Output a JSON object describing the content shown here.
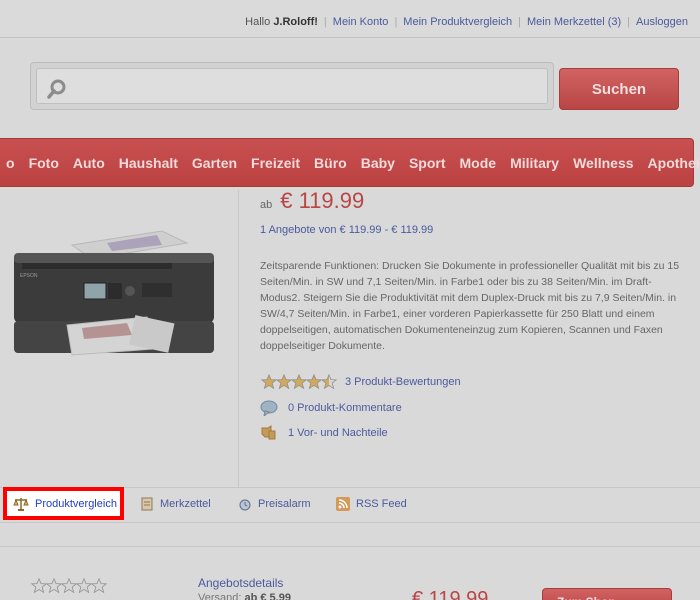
{
  "header": {
    "greeting_prefix": "Hallo",
    "username": "J.Roloff!",
    "links": [
      "Mein Konto",
      "Mein Produktvergleich",
      "Mein Merkzettel (3)",
      "Ausloggen"
    ]
  },
  "search": {
    "value": "",
    "placeholder": "",
    "button_label": "Suchen"
  },
  "nav": {
    "items": [
      "o",
      "Foto",
      "Auto",
      "Haushalt",
      "Garten",
      "Freizeit",
      "Büro",
      "Baby",
      "Sport",
      "Mode",
      "Military",
      "Wellness",
      "Apotheke"
    ]
  },
  "product": {
    "price_prefix": "ab",
    "price": "€ 119.99",
    "offers": "1 Angebote von € 119.99 - € 119.99",
    "description": "Zeitsparende Funktionen: Drucken Sie Dokumente in professioneller Qualität mit bis zu 15 Seiten/Min. in SW und 7,1 Seiten/Min. in Farbe1 oder bis zu 38 Seiten/Min. im Draft-Modus2. Steigern Sie die Produktivität mit dem Duplex-Druck mit bis zu 7,9 Seiten/Min. in SW/4,7 Seiten/Min. in Farbe1, einer vorderen Papierkassette für 250 Blatt und einem doppelseitigen, automatischen Dokumenteneinzug zum Kopieren, Scannen und Faxen doppelseitiger Dokumente.",
    "rating": 4.5,
    "reviews_link": "3 Produkt-Bewertungen",
    "comments_link": "0 Produkt-Kommentare",
    "proscons_link": "1 Vor- und Nachteile"
  },
  "actions": {
    "compare": "Produktvergleich",
    "wishlist": "Merkzettel",
    "price_alert": "Preisalarm",
    "rss": "RSS Feed"
  },
  "offer_row": {
    "details_link": "Angebotsdetails",
    "shipping_label": "Versand:",
    "shipping_value": "ab € 5.99",
    "price": "€ 119.99",
    "shop_button": "Zum Shop"
  },
  "colors": {
    "accent_red": "#b94545",
    "link_blue": "#4a5a9e",
    "highlight": "#ff0000"
  }
}
